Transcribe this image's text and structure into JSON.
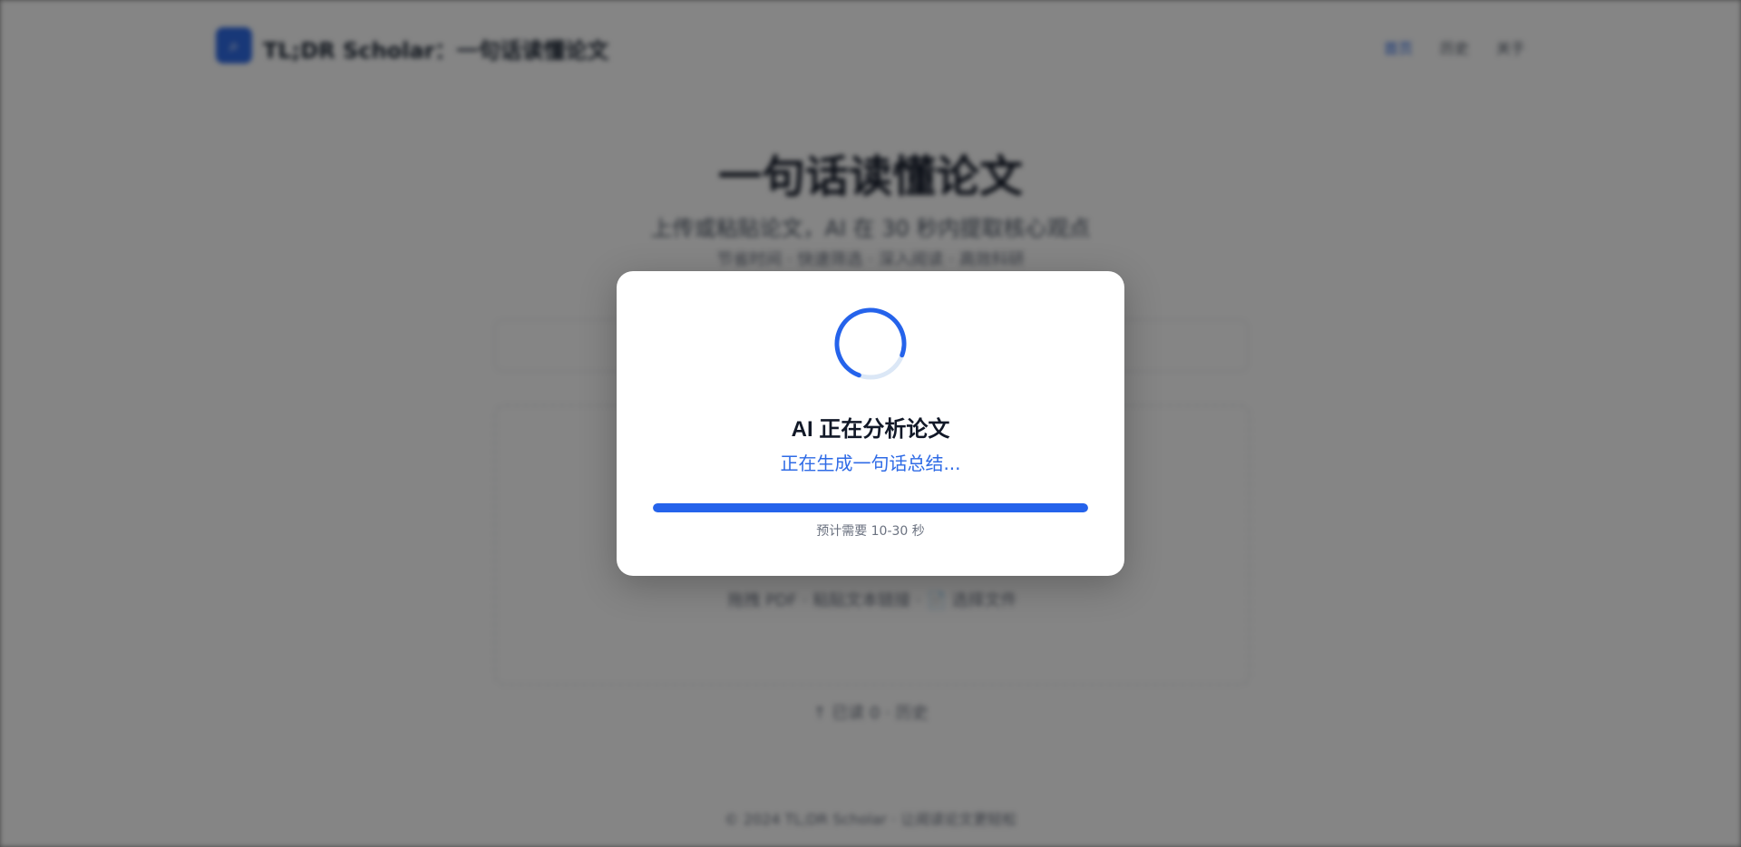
{
  "background_page": {
    "header": {
      "logo_icon": "search-icon",
      "brand": "TL;DR Scholar：一句话读懂论文",
      "nav": [
        {
          "label": "首页",
          "active": true
        },
        {
          "label": "历史",
          "active": false
        },
        {
          "label": "关于",
          "active": false
        }
      ]
    },
    "hero": {
      "title": "一句话读懂论文",
      "subtitle": "上传或粘贴论文，AI 在 30 秒内提取核心观点",
      "subtitle2": "节省时间 · 快速筛选 · 深入阅读 · 高效科研"
    },
    "upload": {
      "hint": "拖拽 PDF · 粘贴文本链接 · 📄 选择文件"
    },
    "history_link": "↑ 已读 0 · 历史",
    "footer": "© 2024 TL;DR Scholar · 让阅读论文更轻松"
  },
  "modal": {
    "spinner_icon": "loading-spinner-icon",
    "title": "AI 正在分析论文",
    "status": "正在生成一句话总结...",
    "progress_percent": 100,
    "eta": "预计需要 10-30 秒"
  },
  "colors": {
    "accent": "#2563eb",
    "overlay": "rgba(0,0,0,0.48)",
    "spinner_track": "#dbe7f6"
  }
}
